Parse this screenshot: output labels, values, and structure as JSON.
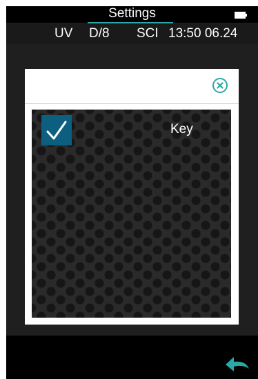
{
  "header": {
    "title": "Settings",
    "battery_icon": "battery-icon"
  },
  "status": {
    "light_source": "UV",
    "geometry": "D/8",
    "mode": "SCI",
    "time": "13:50 06.24"
  },
  "dialog": {
    "close_icon": "close-circle-icon",
    "options": [
      {
        "label": "Key",
        "checked": true
      }
    ]
  },
  "footer": {
    "back_icon": "back-arrow-icon"
  },
  "colors": {
    "accent": "#2aa7a6",
    "checkbox": "#0d5f7f",
    "background": "#1f1f1f"
  }
}
